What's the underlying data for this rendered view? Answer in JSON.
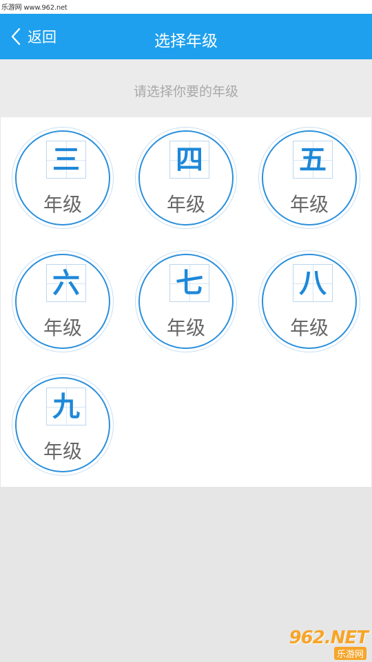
{
  "watermark": {
    "top_text": "乐游网 www.962.net",
    "logo_text": "962.NET",
    "logo_sub": "乐游网"
  },
  "nav": {
    "back_label": "返回",
    "title": "选择年级"
  },
  "hint": "请选择你要的年级",
  "grade_suffix": "年级",
  "grades": [
    {
      "char": "三"
    },
    {
      "char": "四"
    },
    {
      "char": "五"
    },
    {
      "char": "六"
    },
    {
      "char": "七"
    },
    {
      "char": "八"
    },
    {
      "char": "九"
    }
  ],
  "colors": {
    "nav_bg": "#1ea0ee",
    "ring": "#2a8fdc",
    "glyph": "#1e88d8",
    "page_bg": "#e6e6e6"
  }
}
